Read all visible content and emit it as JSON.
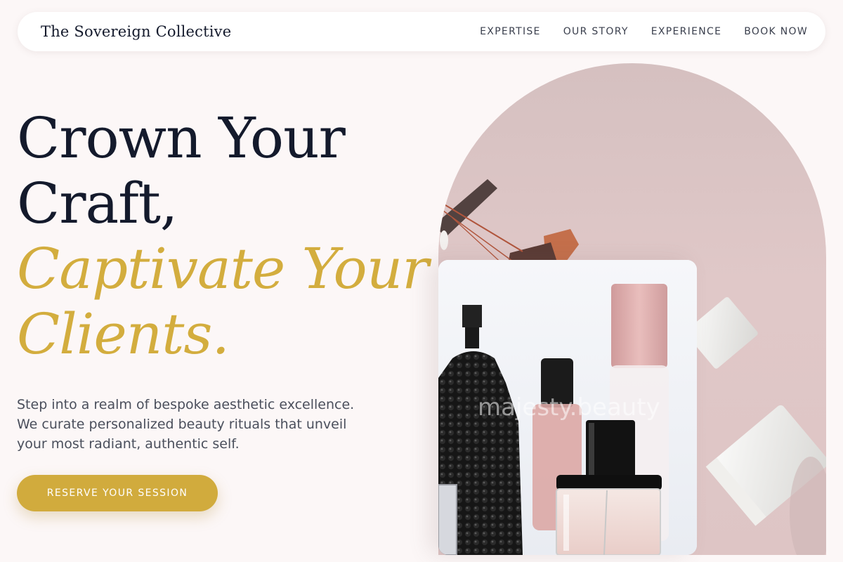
{
  "brand": {
    "name": "The Sovereign Collective"
  },
  "nav": {
    "links": [
      "EXPERTISE",
      "OUR STORY",
      "EXPERIENCE",
      "BOOK NOW"
    ]
  },
  "hero": {
    "headline_lines": [
      "Crown Your",
      "Craft,"
    ],
    "headline_accent_lines": [
      "Captivate Your",
      "Clients."
    ],
    "intro": "Step into a realm of bespoke aesthetic excellence. We curate personalized beauty rituals that unveil your most radiant, authentic self.",
    "cta_label": "RESERVE YOUR SESSION"
  },
  "media": {
    "arch_image_alt": "Skincare bottles and tubes on a pink surface",
    "card_image_alt": "Perfume and serum bottles",
    "watermark": "majesty.beauty"
  },
  "colors": {
    "background": "#fcf7f7",
    "navy": "#141a2c",
    "gold_accent": "#d3ad3e",
    "button_gold": "#d1ab3d",
    "arch_pink": "#d8c2c2"
  }
}
